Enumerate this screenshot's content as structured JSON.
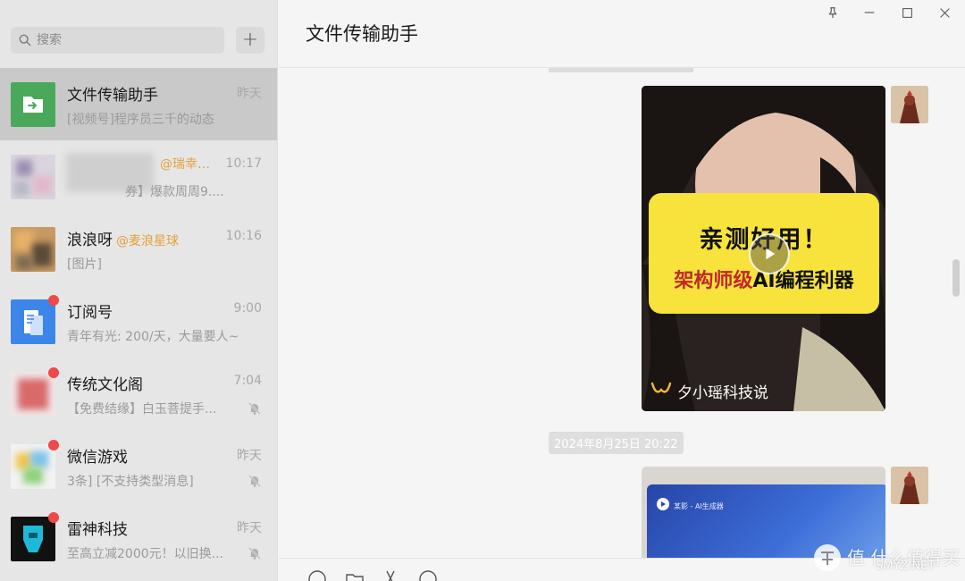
{
  "sidebar": {
    "search": {
      "placeholder": "搜索"
    },
    "add_label": "+",
    "chats": [
      {
        "name": "文件传输助手",
        "mention": "",
        "time": "昨天",
        "preview": "[视频号]程序员三千的动态",
        "badge": false,
        "muted": false,
        "active": true,
        "avatar_icon": "file-transfer-icon"
      },
      {
        "name": "…",
        "mention": "@瑞幸…",
        "time": "10:17",
        "preview": "券】爆款周周9....",
        "badge": false,
        "muted": false,
        "active": false,
        "avatar_icon": "blurred-group-avatar"
      },
      {
        "name": "浪浪呀",
        "mention": "@麦浪星球",
        "time": "10:16",
        "preview": "[图片]",
        "badge": false,
        "muted": false,
        "active": false,
        "avatar_icon": "blurred-group-avatar"
      },
      {
        "name": "订阅号",
        "mention": "",
        "time": "9:00",
        "preview": "青年有光: 200/天，大量要人~",
        "badge": true,
        "muted": false,
        "active": false,
        "avatar_icon": "subscription-icon"
      },
      {
        "name": "传统文化阁",
        "mention": "",
        "time": "7:04",
        "preview": "【免费结缘】白玉菩提手...",
        "badge": true,
        "muted": true,
        "active": false,
        "avatar_icon": "blurred-red-avatar"
      },
      {
        "name": "微信游戏",
        "mention": "",
        "time": "昨天",
        "preview": "3条] [不支持类型消息]",
        "badge": true,
        "muted": true,
        "active": false,
        "avatar_icon": "game-icon"
      },
      {
        "name": "雷神科技",
        "mention": "",
        "time": "昨天",
        "preview": "至高立减2000元！以旧换...",
        "badge": true,
        "muted": true,
        "active": false,
        "avatar_icon": "thunder-robot-icon"
      }
    ]
  },
  "main": {
    "title": "文件传输助手",
    "messages": [
      {
        "type": "video",
        "overlay_line1": "亲测好用！",
        "overlay_line2_red": "架构师级",
        "overlay_line2_rest": "AI编程利器",
        "channel_name": "夕小瑶科技说"
      },
      {
        "type": "timestamp",
        "text": "2024年8月25日 20:22"
      },
      {
        "type": "video",
        "screen_app_label": "某影 - AI生成器"
      }
    ]
  },
  "watermark": {
    "text": "值 什么值得买",
    "sub": "SMYZ.NET"
  },
  "colors": {
    "accent_green": "#4aa85b",
    "badge_red": "#f04848",
    "overlay_yellow": "#f7e33b"
  }
}
